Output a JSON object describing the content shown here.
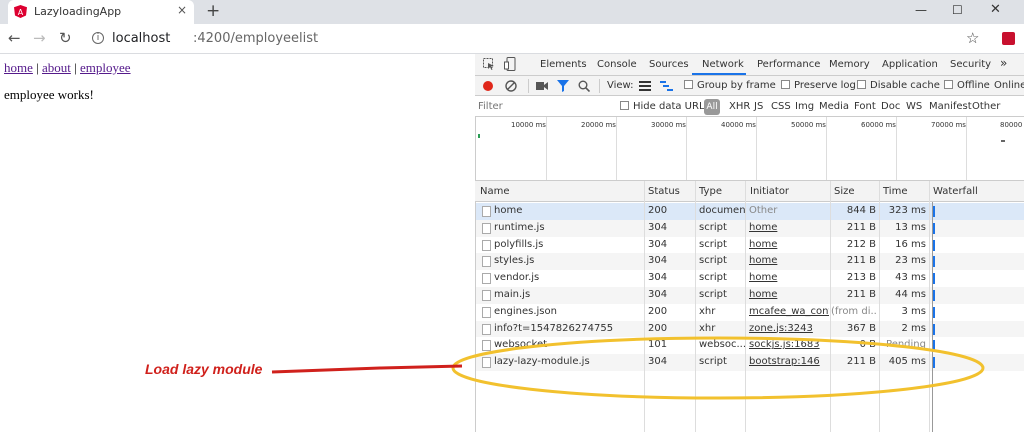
{
  "browser": {
    "tab_title": "LazyloadingApp",
    "tab_close": "×",
    "new_tab": "+",
    "win_min": "—",
    "win_max": "☐",
    "win_close": "✕",
    "nav_back": "←",
    "nav_forward": "→",
    "nav_reload": "↻",
    "url_host": "localhost",
    "url_path": ":4200/employeelist",
    "star": "☆",
    "accent": "#c8102e"
  },
  "page": {
    "links": [
      "home",
      "about",
      "employee"
    ],
    "separator": "|",
    "message": "employee works!"
  },
  "annotation": {
    "label": "Load lazy module",
    "arrow_color": "#d0211c",
    "ellipse_color": "#f2c12e"
  },
  "devtools": {
    "tabs": [
      "Elements",
      "Console",
      "Sources",
      "Network",
      "Performance",
      "Memory",
      "Application",
      "Security"
    ],
    "more": "»",
    "active_tab": "Network",
    "toolbar": {
      "view": "View:",
      "group_by_frame": "Group by frame",
      "preserve_log": "Preserve log",
      "disable_cache": "Disable cache",
      "offline": "Offline",
      "online": "Online"
    },
    "filter": {
      "placeholder": "Filter",
      "hide_data_urls": "Hide data URLs",
      "all": "All",
      "types": [
        "XHR",
        "JS",
        "CSS",
        "Img",
        "Media",
        "Font",
        "Doc",
        "WS",
        "Manifest",
        "Other"
      ]
    },
    "overview_ticks": [
      "10000 ms",
      "20000 ms",
      "30000 ms",
      "40000 ms",
      "50000 ms",
      "60000 ms",
      "70000 ms",
      "80000"
    ],
    "columns": [
      "Name",
      "Status",
      "Type",
      "Initiator",
      "Size",
      "Time",
      "Waterfall"
    ],
    "rows": [
      {
        "name": "home",
        "status": "200",
        "type": "document",
        "initiator": "Other",
        "size": "844 B",
        "time": "323 ms"
      },
      {
        "name": "runtime.js",
        "status": "304",
        "type": "script",
        "initiator": "home",
        "size": "211 B",
        "time": "13 ms"
      },
      {
        "name": "polyfills.js",
        "status": "304",
        "type": "script",
        "initiator": "home",
        "size": "212 B",
        "time": "16 ms"
      },
      {
        "name": "styles.js",
        "status": "304",
        "type": "script",
        "initiator": "home",
        "size": "211 B",
        "time": "23 ms"
      },
      {
        "name": "vendor.js",
        "status": "304",
        "type": "script",
        "initiator": "home",
        "size": "213 B",
        "time": "43 ms"
      },
      {
        "name": "main.js",
        "status": "304",
        "type": "script",
        "initiator": "home",
        "size": "211 B",
        "time": "44 ms"
      },
      {
        "name": "engines.json",
        "status": "200",
        "type": "xhr",
        "initiator": "mcafee_wa_cont...",
        "size": "(from di...",
        "time": "3 ms"
      },
      {
        "name": "info?t=1547826274755",
        "status": "200",
        "type": "xhr",
        "initiator": "zone.js:3243",
        "size": "367 B",
        "time": "2 ms"
      },
      {
        "name": "websocket",
        "status": "101",
        "type": "websoc...",
        "initiator": "sockjs.js:1683",
        "size": "0 B",
        "time": "Pending"
      },
      {
        "name": "lazy-lazy-module.js",
        "status": "304",
        "type": "script",
        "initiator": "bootstrap:146",
        "size": "211 B",
        "time": "405 ms"
      }
    ]
  }
}
